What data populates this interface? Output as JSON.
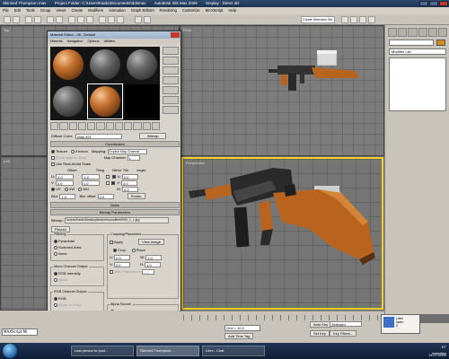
{
  "window": {
    "title_file": "Skinned Thompson.max",
    "title_project": "Project Folder: C:\\Users\\Kaido\\Documents\\3dsmax",
    "title_app": "Autodesk 3ds Max 2009",
    "title_display": "Display : Direct 3D"
  },
  "menu": [
    "File",
    "Edit",
    "Tools",
    "Group",
    "Views",
    "Create",
    "Modifiers",
    "Animation",
    "Graph Editors",
    "Rendering",
    "Customize",
    "MAXScript",
    "Help"
  ],
  "toolbar": {
    "selection_set": "Create Selection Set"
  },
  "viewports": {
    "top": "Top",
    "front": "Front",
    "left": "Left",
    "perspective": "Perspective"
  },
  "command_panel": {
    "modifier_list": "Modifier List"
  },
  "material_editor": {
    "title": "Material Editor - 08 - Default",
    "menu": [
      "Material",
      "Navigation",
      "Options",
      "Utilities"
    ],
    "diffuse_label": "Diffuse Color:",
    "map_name": "Map #21",
    "map_type": "Bitmap",
    "coordinates_rollout": "Coordinates",
    "texture_label": "Texture",
    "environ_label": "Environ",
    "mapping_label": "Mapping:",
    "mapping_value": "Explicit Map Channel",
    "show_map_back": "Show Map on Back",
    "map_channel_label": "Map Channel:",
    "map_channel_value": "1",
    "real_world": "Use Real-World Scale",
    "offset_label": "Offset",
    "tiling_label": "Tiling",
    "mirror_tile_label": "Mirror Tile",
    "angle_label": "Angle",
    "u_label": "U:",
    "v_label": "V:",
    "w_label": "W:",
    "u_offset": "0.0",
    "v_offset": "0.0",
    "u_tiling": "1.0",
    "v_tiling": "1.0",
    "u_angle": "0.0",
    "v_angle": "0.0",
    "w_angle": "0.0",
    "uv": "UV",
    "vw": "VW",
    "wu": "WU",
    "blur_label": "Blur:",
    "blur_value": "1.0",
    "blur_offset_label": "Blur offset:",
    "blur_offset_value": "0.0",
    "rotate": "Rotate",
    "noise_rollout": "Noise",
    "bitmap_params_rollout": "Bitmap Parameters",
    "bitmap_label": "Bitmap:",
    "bitmap_path": "\\Users\\Kaido\\Desktop\\texture\\woodfine0009_1_L.jpg",
    "reload": "Reload",
    "cropping_title": "Cropping/Placement",
    "apply": "Apply",
    "view_image": "View Image",
    "crop": "Crop",
    "place": "Place",
    "crop_u": "0.0",
    "crop_v": "0.0",
    "crop_w": "1.0",
    "crop_h": "1.0",
    "jitter": "Jitter Placement:",
    "jitter_value": "1.0",
    "filtering_title": "Filtering",
    "pyramidal": "Pyramidal",
    "summed_area": "Summed Area",
    "none": "None",
    "mono_title": "Mono Channel Output:",
    "rgb_intensity": "RGB Intensity",
    "alpha": "Alpha",
    "rgb_output_title": "RGB Channel Output:",
    "rgb": "RGB",
    "alpha_as_gray": "Alpha as Gray",
    "alpha_source_title": "Alpha Source",
    "image_alpha": "Image Alpha",
    "none_opaque": "None (Opaque)",
    "premult_alpha": "Premultiplied Alpha"
  },
  "statusbar": {
    "script": "MAXScript Mi",
    "selected": "Selected",
    "auto_key": "Auto Key",
    "set_key": "Set Key",
    "key_filters": "Key Filters...",
    "add_time_tag": "Add Time Tag",
    "grid": "Grid = 10,0"
  },
  "notification": {
    "title": "Litex",
    "line1": "laser",
    "line2": "2"
  },
  "taskbar": {
    "items": [
      "Last person to post...",
      "Skinned Thompson...",
      "Litex - Chat"
    ],
    "lang": "ET",
    "time": "kesipäev",
    "date": "14.07.2009"
  },
  "colors": {
    "wood": "#b8641f",
    "metal": "#2d2d2d",
    "active_viewport": "#f2d021"
  }
}
